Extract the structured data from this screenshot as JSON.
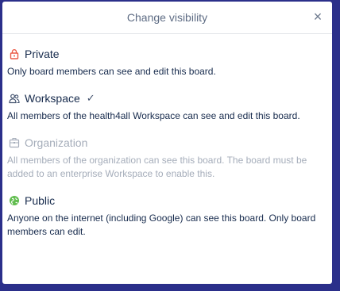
{
  "dialog": {
    "title": "Change visibility",
    "close_label": "×"
  },
  "options": [
    {
      "label": "Private",
      "description": "Only board members can see and edit this board.",
      "icon": "lock-icon",
      "icon_color": "#eb5a46",
      "selected": false,
      "disabled": false
    },
    {
      "label": "Workspace",
      "check": "✓",
      "description": "All members of the health4all Workspace can see and edit this board.",
      "icon": "users-icon",
      "icon_color": "#42526e",
      "selected": true,
      "disabled": false
    },
    {
      "label": "Organization",
      "description": "All members of the organization can see this board. The board must be added to an enterprise Workspace to enable this.",
      "icon": "building-icon",
      "icon_color": "#a5adba",
      "selected": false,
      "disabled": true
    },
    {
      "label": "Public",
      "description": "Anyone on the internet (including Google) can see this board. Only board members can edit.",
      "icon": "globe-icon",
      "icon_color": "#61bd4f",
      "selected": false,
      "disabled": false
    }
  ]
}
